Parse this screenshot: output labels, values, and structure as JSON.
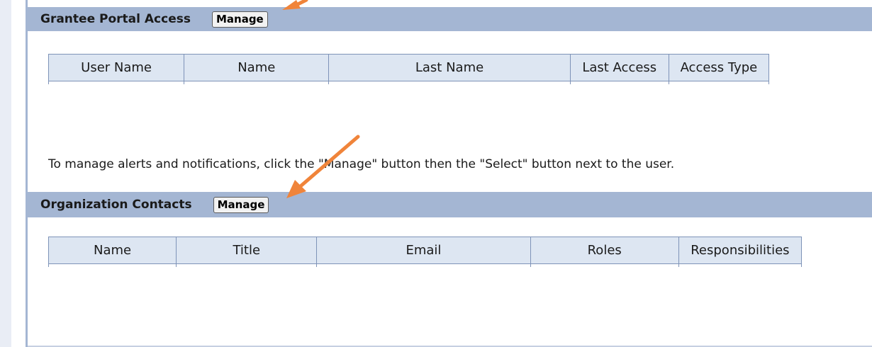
{
  "colors": {
    "header_bg": "#a4b6d3",
    "column_header_bg": "#dde6f2",
    "arrow": "#f0843a"
  },
  "grantee_portal": {
    "title": "Grantee Portal Access",
    "manage_label": "Manage",
    "columns": [
      "User Name",
      "Name",
      "Last Name",
      "Last Access",
      "Access Type"
    ]
  },
  "note": "To manage alerts and notifications, click the \"Manage\" button then the \"Select\" button next to the user.",
  "org_contacts": {
    "title": "Organization Contacts",
    "manage_label": "Manage",
    "columns": [
      "Name",
      "Title",
      "Email",
      "Roles",
      "Responsibilities"
    ]
  },
  "annotations": [
    "arrow-icon",
    "arrow-icon"
  ]
}
